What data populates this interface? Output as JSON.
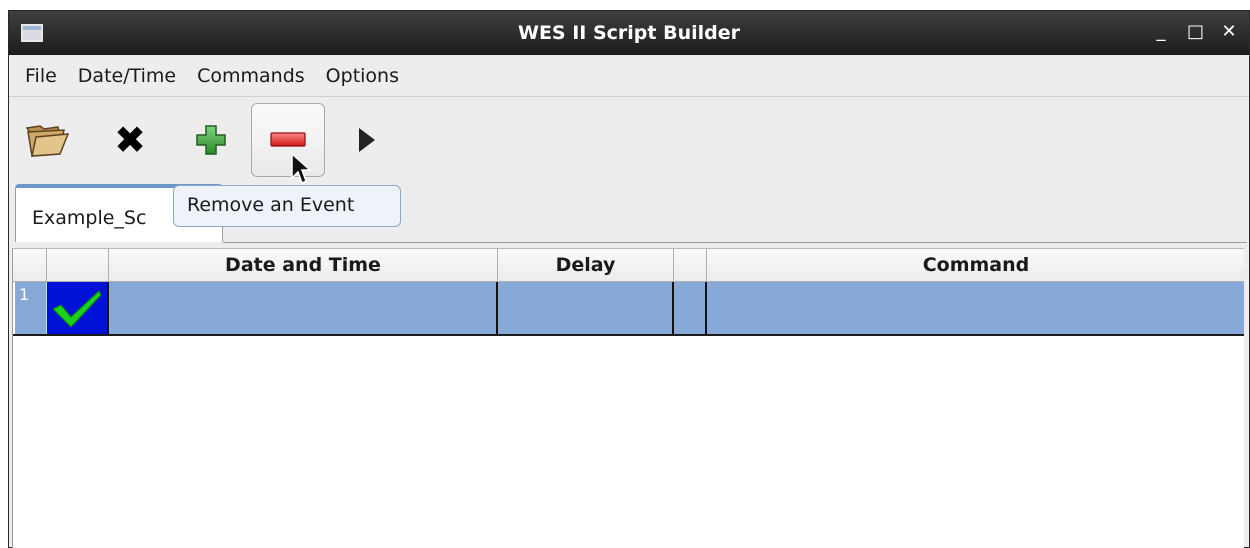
{
  "window": {
    "title": "WES II Script Builder",
    "controls": {
      "minimize": "_",
      "maximize": "□",
      "close": "✕"
    }
  },
  "menubar": {
    "items": [
      "File",
      "Date/Time",
      "Commands",
      "Options"
    ]
  },
  "toolbar": {
    "icons": {
      "open": "folder-icon",
      "close": "x-icon",
      "add": "plus-icon",
      "remove": "minus-icon",
      "run": "play-icon"
    },
    "close_glyph": "✖",
    "hovered": "remove",
    "tooltip": "Remove an Event"
  },
  "tabs": [
    {
      "label": "Example_Sc",
      "active": true
    }
  ],
  "table": {
    "columns": [
      "",
      "",
      "Date and Time",
      "Delay",
      "",
      "Command"
    ],
    "rows": [
      {
        "index": "1",
        "status": "check-icon",
        "date_time": "",
        "delay": "",
        "flag": "",
        "command": "",
        "selected": true
      }
    ]
  },
  "colors": {
    "selection": "#87a9d7",
    "status_cell": "#0012d8",
    "check": "#1bd21b",
    "tab_accent": "#6d97c8"
  }
}
